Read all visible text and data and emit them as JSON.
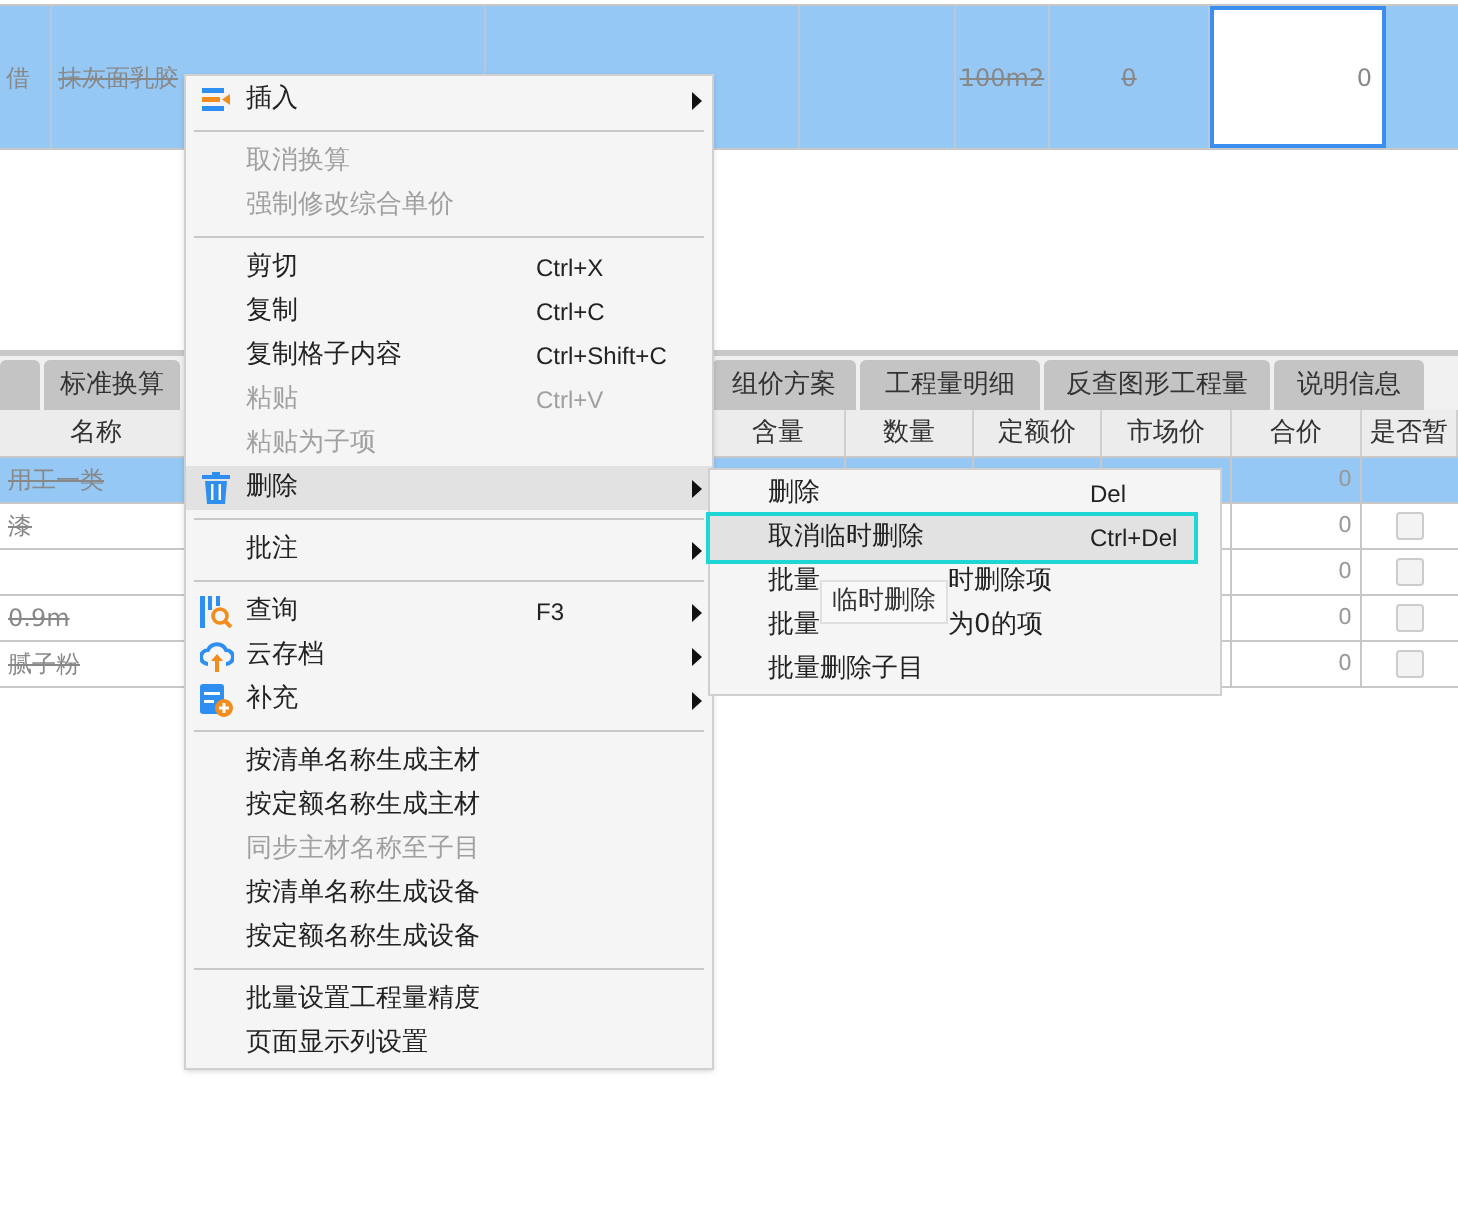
{
  "top_row": {
    "selected": true,
    "cells": [
      {
        "text": "借",
        "strike": false
      },
      {
        "text": "抹灰面乳胶",
        "strike": true
      },
      {
        "text": "100m2",
        "strike": true
      },
      {
        "text": "0",
        "strike": true
      }
    ],
    "editing_cell": {
      "value": "0"
    }
  },
  "tabs": [
    {
      "selected": false
    },
    {
      "label": "标准换算",
      "selected": false
    },
    {
      "label": "组价方案",
      "selected": false
    },
    {
      "label": "工程量明细",
      "selected": false
    },
    {
      "label": "反查图形工程量",
      "selected": false
    },
    {
      "label": "说明信息",
      "selected": false
    }
  ],
  "table": {
    "columns": [
      "名称",
      "含量",
      "数量",
      "定额价",
      "市场价",
      "合价",
      "是否暂"
    ],
    "rows": [
      {
        "name": "用工一类",
        "strike": true,
        "selected": true,
        "total": "0"
      },
      {
        "name": "漆",
        "strike": true,
        "selected": false,
        "total": "0",
        "checked": false
      },
      {
        "selected": false,
        "total": "0",
        "checked": false
      },
      {
        "name": "0.9m",
        "strike": true,
        "selected": false,
        "total": "0",
        "checked": false
      },
      {
        "name": "腻子粉",
        "strike": true,
        "selected": false,
        "total": "0",
        "checked": false
      }
    ]
  },
  "context_menu": {
    "items": [
      {
        "kind": "item",
        "label": "插入",
        "submenu": true,
        "disabled": false,
        "selected": false
      },
      {
        "kind": "separator"
      },
      {
        "kind": "item",
        "label": "取消换算",
        "disabled": true,
        "selected": false
      },
      {
        "kind": "item",
        "label": "强制修改综合单价",
        "disabled": true,
        "selected": false
      },
      {
        "kind": "separator"
      },
      {
        "kind": "item",
        "label": "剪切",
        "shortcut": "Ctrl+X",
        "disabled": false,
        "selected": false
      },
      {
        "kind": "item",
        "label": "复制",
        "shortcut": "Ctrl+C",
        "disabled": false,
        "selected": false
      },
      {
        "kind": "item",
        "label": "复制格子内容",
        "shortcut": "Ctrl+Shift+C",
        "disabled": false,
        "selected": false
      },
      {
        "kind": "item",
        "label": "粘贴",
        "shortcut": "Ctrl+V",
        "disabled": true,
        "selected": false
      },
      {
        "kind": "item",
        "label": "粘贴为子项",
        "disabled": true,
        "selected": false
      },
      {
        "kind": "item",
        "label": "删除",
        "submenu": true,
        "disabled": false,
        "selected": true
      },
      {
        "kind": "separator"
      },
      {
        "kind": "item",
        "label": "批注",
        "submenu": true,
        "disabled": false,
        "selected": false
      },
      {
        "kind": "separator"
      },
      {
        "kind": "item",
        "label": "查询",
        "shortcut": "F3",
        "submenu": true,
        "disabled": false,
        "selected": false
      },
      {
        "kind": "item",
        "label": "云存档",
        "submenu": true,
        "disabled": false,
        "selected": false
      },
      {
        "kind": "item",
        "label": "补充",
        "submenu": true,
        "disabled": false,
        "selected": false
      },
      {
        "kind": "separator"
      },
      {
        "kind": "item",
        "label": "按清单名称生成主材",
        "disabled": false,
        "selected": false
      },
      {
        "kind": "item",
        "label": "按定额名称生成主材",
        "disabled": false,
        "selected": false
      },
      {
        "kind": "item",
        "label": "同步主材名称至子目",
        "disabled": true,
        "selected": false
      },
      {
        "kind": "item",
        "label": "按清单名称生成设备",
        "disabled": false,
        "selected": false
      },
      {
        "kind": "item",
        "label": "按定额名称生成设备",
        "disabled": false,
        "selected": false
      },
      {
        "kind": "separator"
      },
      {
        "kind": "item",
        "label": "批量设置工程量精度",
        "disabled": false,
        "selected": false
      },
      {
        "kind": "item",
        "label": "页面显示列设置",
        "disabled": false,
        "selected": false
      }
    ]
  },
  "submenu": {
    "items": [
      {
        "label": "删除",
        "shortcut": "Del",
        "selected": false
      },
      {
        "label": "取消临时删除",
        "shortcut": "Ctrl+Del",
        "selected": true
      },
      {
        "label": "批量",
        "label_end": "时删除项",
        "selected": false
      },
      {
        "label": "批量",
        "label_end": "为0的项",
        "selected": false
      },
      {
        "label": "批量删除子目",
        "selected": false
      }
    ]
  },
  "tooltip": {
    "text": "临时删除"
  }
}
